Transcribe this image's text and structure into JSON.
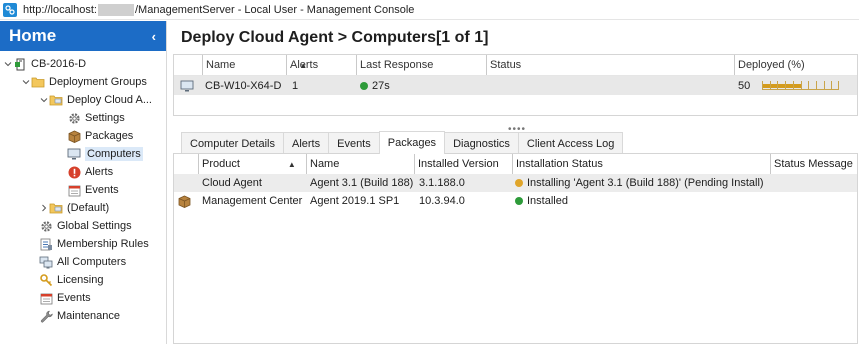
{
  "window": {
    "title_prefix": "http://localhost:",
    "title_suffix": "/ManagementServer - Local User - Management Console"
  },
  "sidebar": {
    "home_label": "Home",
    "collapse_label": "‹",
    "tree": [
      {
        "label": "CB-2016-D",
        "icon": "computer-server-icon",
        "expanded": true
      },
      {
        "label": "Deployment Groups",
        "icon": "folder-icon",
        "expanded": true
      },
      {
        "label": "Deploy Cloud A...",
        "icon": "folder-icon",
        "expanded": true
      },
      {
        "label": "Settings",
        "icon": "gear-icon"
      },
      {
        "label": "Packages",
        "icon": "package-icon"
      },
      {
        "label": "Computers",
        "icon": "monitor-icon",
        "selected": true
      },
      {
        "label": "Alerts",
        "icon": "alert-icon"
      },
      {
        "label": "Events",
        "icon": "calendar-icon"
      },
      {
        "label": "(Default)",
        "icon": "folder-icon",
        "expanded": false
      },
      {
        "label": "Global Settings",
        "icon": "gear-icon"
      },
      {
        "label": "Membership Rules",
        "icon": "rules-icon"
      },
      {
        "label": "All Computers",
        "icon": "computers-icon"
      },
      {
        "label": "Licensing",
        "icon": "key-icon"
      },
      {
        "label": "Events",
        "icon": "calendar-icon"
      },
      {
        "label": "Maintenance",
        "icon": "wrench-icon"
      }
    ]
  },
  "main": {
    "page_title": "Deploy Cloud Agent > Computers[1 of 1]",
    "computers_grid": {
      "columns": [
        "Name",
        "Alerts",
        "Last Response",
        "Status",
        "Deployed (%)"
      ],
      "rows": [
        {
          "name": "CB-W10-X64-D",
          "alerts": "1",
          "last_response": "27s",
          "status": "",
          "deployed": "50",
          "deployed_fraction": 0.5
        }
      ]
    },
    "tabs": [
      "Computer Details",
      "Alerts",
      "Events",
      "Packages",
      "Diagnostics",
      "Client Access Log"
    ],
    "active_tab": "Packages",
    "packages_grid": {
      "columns": [
        "Product",
        "Name",
        "Installed Version",
        "Installation Status",
        "Status Message"
      ],
      "rows": [
        {
          "product": "Cloud Agent",
          "name": "Agent 3.1 (Build 188)",
          "installed_version": "3.1.188.0",
          "installation_status": "Installing 'Agent 3.1 (Build 188)' (Pending Install)",
          "status_color": "#e0a52a",
          "status_message": ""
        },
        {
          "product": "Management Center",
          "name": "Agent 2019.1 SP1",
          "installed_version": "10.3.94.0",
          "installation_status": "Installed",
          "status_color": "#2e9b3a",
          "status_message": ""
        }
      ]
    }
  },
  "colors": {
    "home_header": "#1c6cc6",
    "selected_row": "#e8e8e8",
    "online_dot": "#2e9b3a",
    "pending_dot": "#e0a52a",
    "progress_fill": "#d49b1c"
  }
}
